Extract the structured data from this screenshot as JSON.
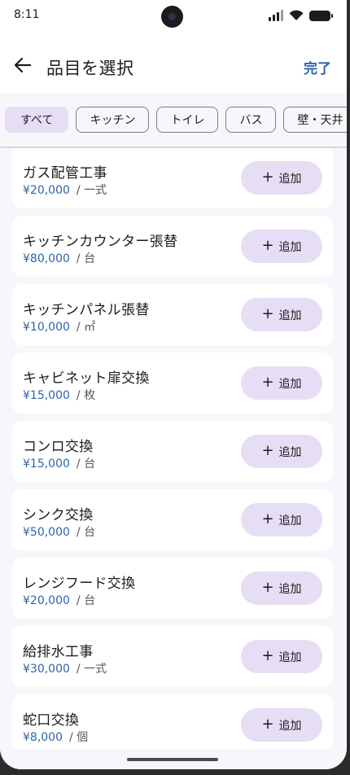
{
  "status_bar": {
    "time": "8:11",
    "icons": [
      "signal-icon",
      "wifi-icon",
      "battery-icon"
    ]
  },
  "header": {
    "title": "品目を選択",
    "done_label": "完了",
    "back_icon": "arrow-left-icon"
  },
  "chips": [
    {
      "label": "すべて",
      "selected": true
    },
    {
      "label": "キッチン",
      "selected": false
    },
    {
      "label": "トイレ",
      "selected": false
    },
    {
      "label": "バス",
      "selected": false
    },
    {
      "label": "壁・天井",
      "selected": false
    }
  ],
  "add_label": "追加",
  "items": [
    {
      "name": "ガス配管工事",
      "price": "¥20,000",
      "unit": "/ 一式"
    },
    {
      "name": "キッチンカウンター張替",
      "price": "¥80,000",
      "unit": "/ 台"
    },
    {
      "name": "キッチンパネル張替",
      "price": "¥10,000",
      "unit": "/ ㎡"
    },
    {
      "name": "キャビネット扉交換",
      "price": "¥15,000",
      "unit": "/ 枚"
    },
    {
      "name": "コンロ交換",
      "price": "¥15,000",
      "unit": "/ 台"
    },
    {
      "name": "シンク交換",
      "price": "¥50,000",
      "unit": "/ 台"
    },
    {
      "name": "レンジフード交換",
      "price": "¥20,000",
      "unit": "/ 台"
    },
    {
      "name": "給排水工事",
      "price": "¥30,000",
      "unit": "/ 一式"
    },
    {
      "name": "蛇口交換",
      "price": "¥8,000",
      "unit": "/ 個"
    }
  ],
  "colors": {
    "accent": "#2f64a8",
    "chip_selected": "#e6def4",
    "add_button": "#e6def4"
  }
}
